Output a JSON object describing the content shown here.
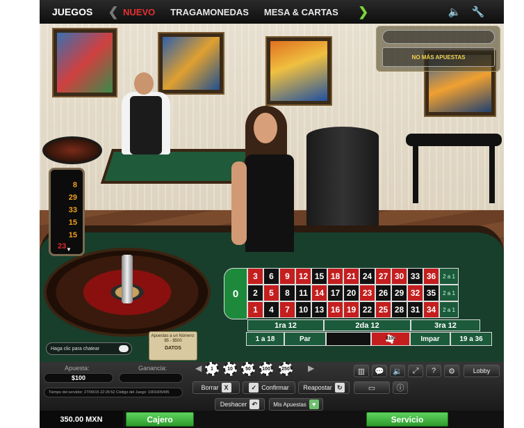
{
  "nav": {
    "brand": "JUEGOS",
    "tabs": [
      {
        "label": "NUEVO",
        "active": true
      },
      {
        "label": "TRAGAMONEDAS",
        "active": false
      },
      {
        "label": "MESA & CARTAS",
        "active": false
      }
    ],
    "icons": [
      "chevron-left-icon",
      "chevron-right-icon",
      "speaker-icon",
      "wrench-icon"
    ]
  },
  "status": {
    "round_message": "NO MÁS APUESTAS"
  },
  "history": {
    "results": [
      {
        "n": "8",
        "color": "#f0a020"
      },
      {
        "n": "29",
        "color": "#f0a020"
      },
      {
        "n": "33",
        "color": "#f0a020"
      },
      {
        "n": "15",
        "color": "#f0a020"
      },
      {
        "n": "15",
        "color": "#f0a020"
      },
      {
        "n": "23",
        "color": "#e22a2a"
      }
    ]
  },
  "board": {
    "zero": "0",
    "rows": [
      [
        {
          "n": "3",
          "c": "red"
        },
        {
          "n": "6",
          "c": "black"
        },
        {
          "n": "9",
          "c": "red"
        },
        {
          "n": "12",
          "c": "red"
        },
        {
          "n": "15",
          "c": "black"
        },
        {
          "n": "18",
          "c": "red"
        },
        {
          "n": "21",
          "c": "red"
        },
        {
          "n": "24",
          "c": "black"
        },
        {
          "n": "27",
          "c": "red"
        },
        {
          "n": "30",
          "c": "red"
        },
        {
          "n": "33",
          "c": "black"
        },
        {
          "n": "36",
          "c": "red"
        }
      ],
      [
        {
          "n": "2",
          "c": "black"
        },
        {
          "n": "5",
          "c": "red"
        },
        {
          "n": "8",
          "c": "black"
        },
        {
          "n": "11",
          "c": "black"
        },
        {
          "n": "14",
          "c": "red"
        },
        {
          "n": "17",
          "c": "black"
        },
        {
          "n": "20",
          "c": "black"
        },
        {
          "n": "23",
          "c": "red"
        },
        {
          "n": "26",
          "c": "black"
        },
        {
          "n": "29",
          "c": "black"
        },
        {
          "n": "32",
          "c": "red"
        },
        {
          "n": "35",
          "c": "black"
        }
      ],
      [
        {
          "n": "1",
          "c": "red"
        },
        {
          "n": "4",
          "c": "black"
        },
        {
          "n": "7",
          "c": "red"
        },
        {
          "n": "10",
          "c": "black"
        },
        {
          "n": "13",
          "c": "black"
        },
        {
          "n": "16",
          "c": "red"
        },
        {
          "n": "19",
          "c": "red"
        },
        {
          "n": "22",
          "c": "black"
        },
        {
          "n": "25",
          "c": "red"
        },
        {
          "n": "28",
          "c": "black"
        },
        {
          "n": "31",
          "c": "black"
        },
        {
          "n": "34",
          "c": "red"
        }
      ]
    ],
    "columns": [
      "2 a 1",
      "2 a 1",
      "2 a 1"
    ],
    "dozens": [
      "1ra 12",
      "2da 12",
      "3ra 12"
    ],
    "outside": [
      "1 a 18",
      "Par",
      "",
      "",
      "Impar",
      "19 a 36"
    ],
    "chip_label": "$100"
  },
  "chat": {
    "placeholder": "Haga clic para chatear"
  },
  "limits": {
    "text": "Apuestas a un Número: $5 - $500",
    "link": "DATOS"
  },
  "panel": {
    "bet_label": "Apuesta:",
    "bet_value": "$100",
    "win_label": "Ganancia:",
    "win_value": "",
    "server_info": "Tiempo del servidor: 27/09/15 22:26:52 Código del Juego: 1001605495",
    "chips": [
      "1",
      "10",
      "50",
      "100",
      "250"
    ],
    "clear": "Borrar",
    "clear_icon": "X",
    "confirm": "Confirmar",
    "confirm_icon": "✓",
    "rebet": "Reapostar",
    "rebet_icon": "↻",
    "undo": "Deshacer",
    "undo_icon": "↶",
    "my_bets": "Mis Apuestas",
    "my_bets_icon": "♥",
    "lobby": "Lobby"
  },
  "bottom": {
    "balance": "350.00 MXN",
    "cashier": "Cajero",
    "service": "Servicio"
  }
}
